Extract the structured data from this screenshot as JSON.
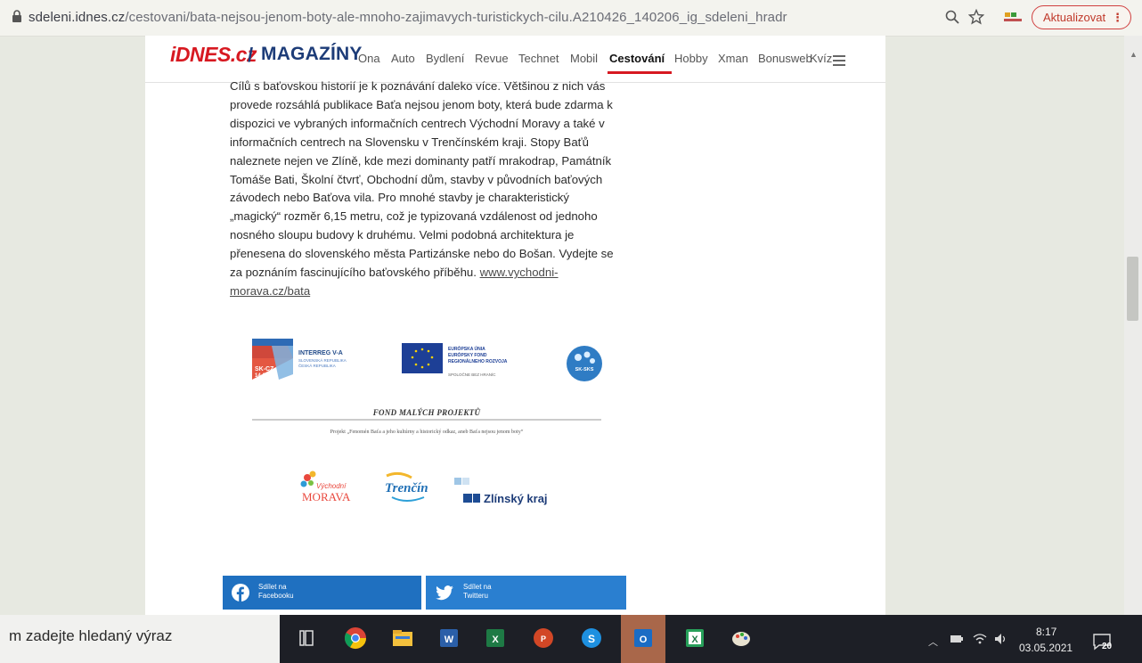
{
  "browser": {
    "url_host": "sdeleni.idnes.cz",
    "url_path": "/cestovani/bata-nejsou-jenom-boty-ale-mnoho-zajimavych-turistickych-cilu.A210426_140206_ig_sdeleni_hradr",
    "update_button": "Aktualizovat",
    "update_dots": "⋮"
  },
  "site": {
    "logo": "iDNES.cz",
    "separator": "/",
    "section": "MAGAZÍNY",
    "nav": [
      "Ona",
      "Auto",
      "Bydlení",
      "Revue",
      "Technet",
      "Mobil",
      "Cestování",
      "Hobby",
      "Xman",
      "Bonusweb",
      "Kvíz"
    ],
    "active_nav": "Cestování"
  },
  "article": {
    "lines": [
      "Cílů s baťovskou historií je k poznávání daleko více. Většinou z nich vás",
      "provede rozsáhlá publikace Baťa nejsou jenom boty, která bude zdarma k",
      "dispozici ve vybraných informačních centrech Východní Moravy a také v",
      "informačních centrech na Slovensku v Trenčínském kraji. Stopy Baťů",
      "naleznete nejen ve Zlíně, kde mezi dominanty patří mrakodrap, Památník",
      "Tomáše Bati, Školní čtvrť, Obchodní dům, stavby v původních baťových",
      "závodech nebo Baťova vila. Pro mnohé stavby je charakteristický",
      "„magický“ rozměr 6,15 metru, což je typizovaná vzdálenost od jednoho",
      "nosného sloupu budovy k druhému. Velmi podobná architektura je",
      "přenesena do slovenského města Partizánske nebo do Bošan. Vydejte se",
      "za poznáním fascinujícího baťovského příběhu. "
    ],
    "link_part1": "www.vychodni-",
    "link_part2": "morava.cz/bata"
  },
  "logos": {
    "interreg_title": "INTERREG V-A",
    "interreg_sub1": "SLOVENSKÁ REPUBLIKA",
    "interreg_sub2": "ČESKÁ REPUBLIKA",
    "interreg_code": "SK-CZ",
    "interreg_years": "14-20",
    "eu_line1": "EURÓPSKA ÚNIA",
    "eu_line2": "EURÓPSKY FOND",
    "eu_line3": "REGIONÁLNEHO ROZVOJA",
    "eu_motto": "SPOLOČNE BEZ HRANÍC",
    "sksk": "SK-SKS",
    "fond_title": "FOND MALÝCH PROJEKTŮ",
    "fond_sub": "Projekt „Fenomén Baťa a jeho kultúrny a historický odkaz, aneb Baťa nejsou jenom boty“",
    "vm_line1": "Východní",
    "vm_line2": "MORAVA",
    "trencin": "Trenčín",
    "zlin": "Zlínský kraj"
  },
  "share": {
    "facebook_line1": "Sdílet na",
    "facebook_line2": "Facebooku",
    "twitter_line1": "Sdílet na",
    "twitter_line2": "Twitteru"
  },
  "taskbar": {
    "search_text": "m zadejte hledaný výraz",
    "time": "8:17",
    "date": "03.05.2021",
    "notifications": "20"
  },
  "colors": {
    "brand_red": "#d71921",
    "brand_blue": "#1d3c78",
    "facebook": "#1f70c0",
    "twitter": "#2a7fd0"
  }
}
